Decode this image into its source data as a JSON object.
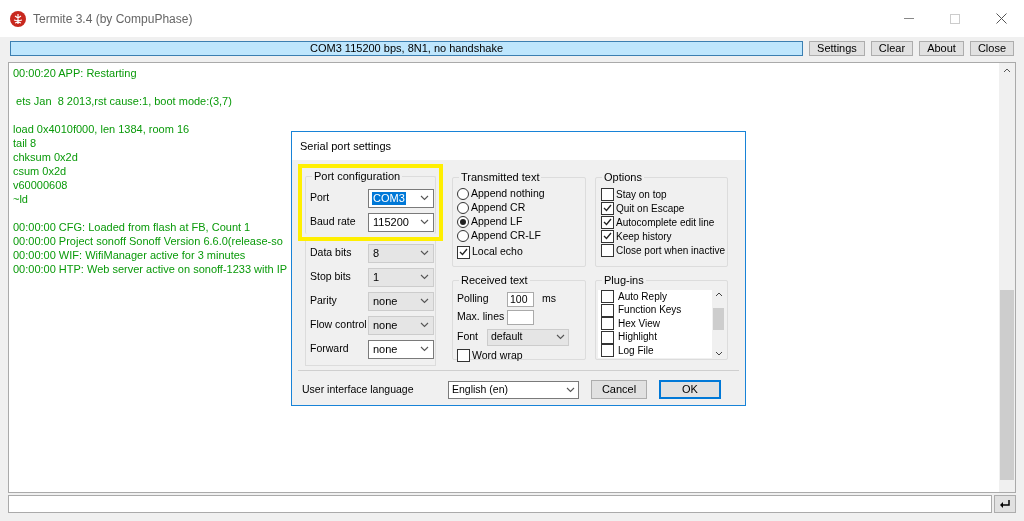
{
  "window": {
    "title": "Termite 3.4 (by CompuPhase)"
  },
  "toolbar": {
    "status": "COM3 115200 bps, 8N1, no handshake",
    "buttons": [
      "Settings",
      "Clear",
      "About",
      "Close"
    ]
  },
  "terminal": {
    "blocks": [
      {
        "lines": [
          "00:00:20 APP: Restarting"
        ]
      },
      {
        "lines": [
          " ets Jan  8 2013,rst cause:1, boot mode:(3,7)"
        ]
      },
      {
        "lines": [
          "load 0x4010f000, len 1384, room 16",
          "tail 8",
          "chksum 0x2d",
          "csum 0x2d",
          "v60000608",
          "~ld"
        ]
      },
      {
        "lines": [
          "00:00:00 CFG: Loaded from flash at FB, Count 1",
          "00:00:00 Project sonoff Sonoff Version 6.6.0(release-so",
          "00:00:00 WIF: WifiManager active for 3 minutes",
          "00:00:00 HTP: Web server active on sonoff-1233 with IP"
        ]
      }
    ]
  },
  "dialog": {
    "title": "Serial port settings",
    "port_configuration": {
      "title": "Port configuration",
      "highlighted_fields": [
        {
          "label": "Port",
          "value": "COM3",
          "disabled": false,
          "text_selected": true
        },
        {
          "label": "Baud rate",
          "value": "115200",
          "disabled": false,
          "text_selected": false
        }
      ],
      "fields": [
        {
          "label": "Data bits",
          "value": "8",
          "disabled": true,
          "text_selected": false
        },
        {
          "label": "Stop bits",
          "value": "1",
          "disabled": true,
          "text_selected": false
        },
        {
          "label": "Parity",
          "value": "none",
          "disabled": true,
          "text_selected": false
        },
        {
          "label": "Flow control",
          "value": "none",
          "disabled": true,
          "text_selected": false
        },
        {
          "label": "Forward",
          "value": "none",
          "disabled": false,
          "text_selected": false
        }
      ]
    },
    "transmitted_text": {
      "title": "Transmitted text",
      "radios": [
        {
          "label": "Append nothing",
          "selected": false
        },
        {
          "label": "Append CR",
          "selected": false
        },
        {
          "label": "Append LF",
          "selected": true
        },
        {
          "label": "Append CR-LF",
          "selected": false
        }
      ],
      "local_echo": {
        "label": "Local echo",
        "checked": true
      }
    },
    "received_text": {
      "title": "Received text",
      "polling": {
        "label": "Polling",
        "value": "100",
        "unit": "ms"
      },
      "max_lines": {
        "label": "Max. lines"
      },
      "font": {
        "label": "Font",
        "value": "default"
      },
      "word_wrap": {
        "label": "Word wrap",
        "checked": false
      }
    },
    "options": {
      "title": "Options",
      "items": [
        {
          "label": "Stay on top",
          "checked": false
        },
        {
          "label": "Quit on Escape",
          "checked": true
        },
        {
          "label": "Autocomplete edit line",
          "checked": true
        },
        {
          "label": "Keep history",
          "checked": true
        },
        {
          "label": "Close port when inactive",
          "checked": false
        }
      ]
    },
    "plugins": {
      "title": "Plug-ins",
      "items": [
        {
          "label": "Auto Reply",
          "checked": false
        },
        {
          "label": "Function Keys",
          "checked": false
        },
        {
          "label": "Hex View",
          "checked": false
        },
        {
          "label": "Highlight",
          "checked": false
        },
        {
          "label": "Log File",
          "checked": false
        }
      ]
    },
    "language": {
      "label": "User interface language",
      "value": "English (en)"
    },
    "buttons": [
      {
        "label": "Cancel",
        "default": false
      },
      {
        "label": "OK",
        "default": true
      }
    ]
  }
}
